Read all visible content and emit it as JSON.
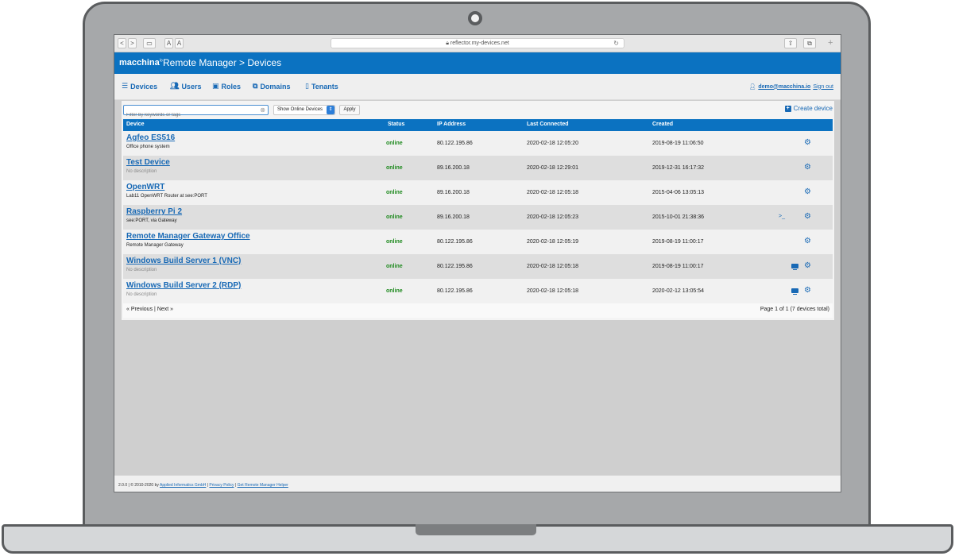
{
  "browser": {
    "url": "reflector.my-devices.net",
    "back_label": "<",
    "forward_label": ">",
    "text_small_label": "A",
    "text_large_label": "A"
  },
  "app": {
    "logo": "macchina",
    "logo_mark": "io",
    "title": "Remote Manager > Devices"
  },
  "nav": {
    "items": [
      {
        "label": "Devices",
        "icon": "list-icon"
      },
      {
        "label": "Users",
        "icon": "users-icon"
      },
      {
        "label": "Roles",
        "icon": "roles-icon"
      },
      {
        "label": "Domains",
        "icon": "domains-icon"
      },
      {
        "label": "Tenants",
        "icon": "tenants-icon"
      }
    ],
    "user": "demo@macchina.io",
    "signout": "Sign out"
  },
  "toolbar": {
    "filter_placeholder": "Filter by keywords or tags",
    "filter_value": "",
    "select_value": "Show Online Devices",
    "apply_label": "Apply",
    "create_label": "Create device"
  },
  "table": {
    "headers": {
      "device": "Device",
      "status": "Status",
      "ip": "IP Address",
      "last_connected": "Last Connected",
      "created": "Created"
    },
    "rows": [
      {
        "name": "Agfeo ES516",
        "desc": "Office phone system",
        "status": "online",
        "ip": "80.122.195.86",
        "last": "2020-02-18 12:05:20",
        "created": "2019-08-19 11:06:50"
      },
      {
        "name": "Test Device",
        "desc": "No description",
        "status": "online",
        "ip": "89.16.200.18",
        "last": "2020-02-18 12:29:01",
        "created": "2019-12-31 16:17:32"
      },
      {
        "name": "OpenWRT",
        "desc": "Lab11 OpenWRT Router at see:PORT",
        "status": "online",
        "ip": "89.16.200.18",
        "last": "2020-02-18 12:05:18",
        "created": "2015-04-06 13:05:13"
      },
      {
        "name": "Raspberry Pi 2",
        "desc": "see:PORT, via Gateway",
        "status": "online",
        "ip": "89.16.200.18",
        "last": "2020-02-18 12:05:23",
        "created": "2015-10-01 21:38:36"
      },
      {
        "name": "Remote Manager Gateway Office",
        "desc": "Remote Manager Gateway",
        "status": "online",
        "ip": "80.122.195.86",
        "last": "2020-02-18 12:05:19",
        "created": "2019-08-19 11:00:17"
      },
      {
        "name": "Windows Build Server 1 (VNC)",
        "desc": "No description",
        "status": "online",
        "ip": "80.122.195.86",
        "last": "2020-02-18 12:05:18",
        "created": "2019-08-19 11:00:17"
      },
      {
        "name": "Windows Build Server 2 (RDP)",
        "desc": "No description",
        "status": "online",
        "ip": "80.122.195.86",
        "last": "2020-02-18 12:05:18",
        "created": "2020-02-12 13:05:54"
      }
    ]
  },
  "pager": {
    "prev": "« Previous",
    "separator": "|",
    "next": "Next »",
    "total": "Page 1 of 1 (7 devices total)"
  },
  "footer": {
    "version": "2.0.0 | © 2010-2020 by",
    "company": "Applied Informatics GmbH",
    "privacy": "Privacy Policy",
    "helper": "Get Remote Manager Helper"
  },
  "colors": {
    "brand": "#0b72c1",
    "link": "#1869b5",
    "online": "#1f8a1f"
  }
}
